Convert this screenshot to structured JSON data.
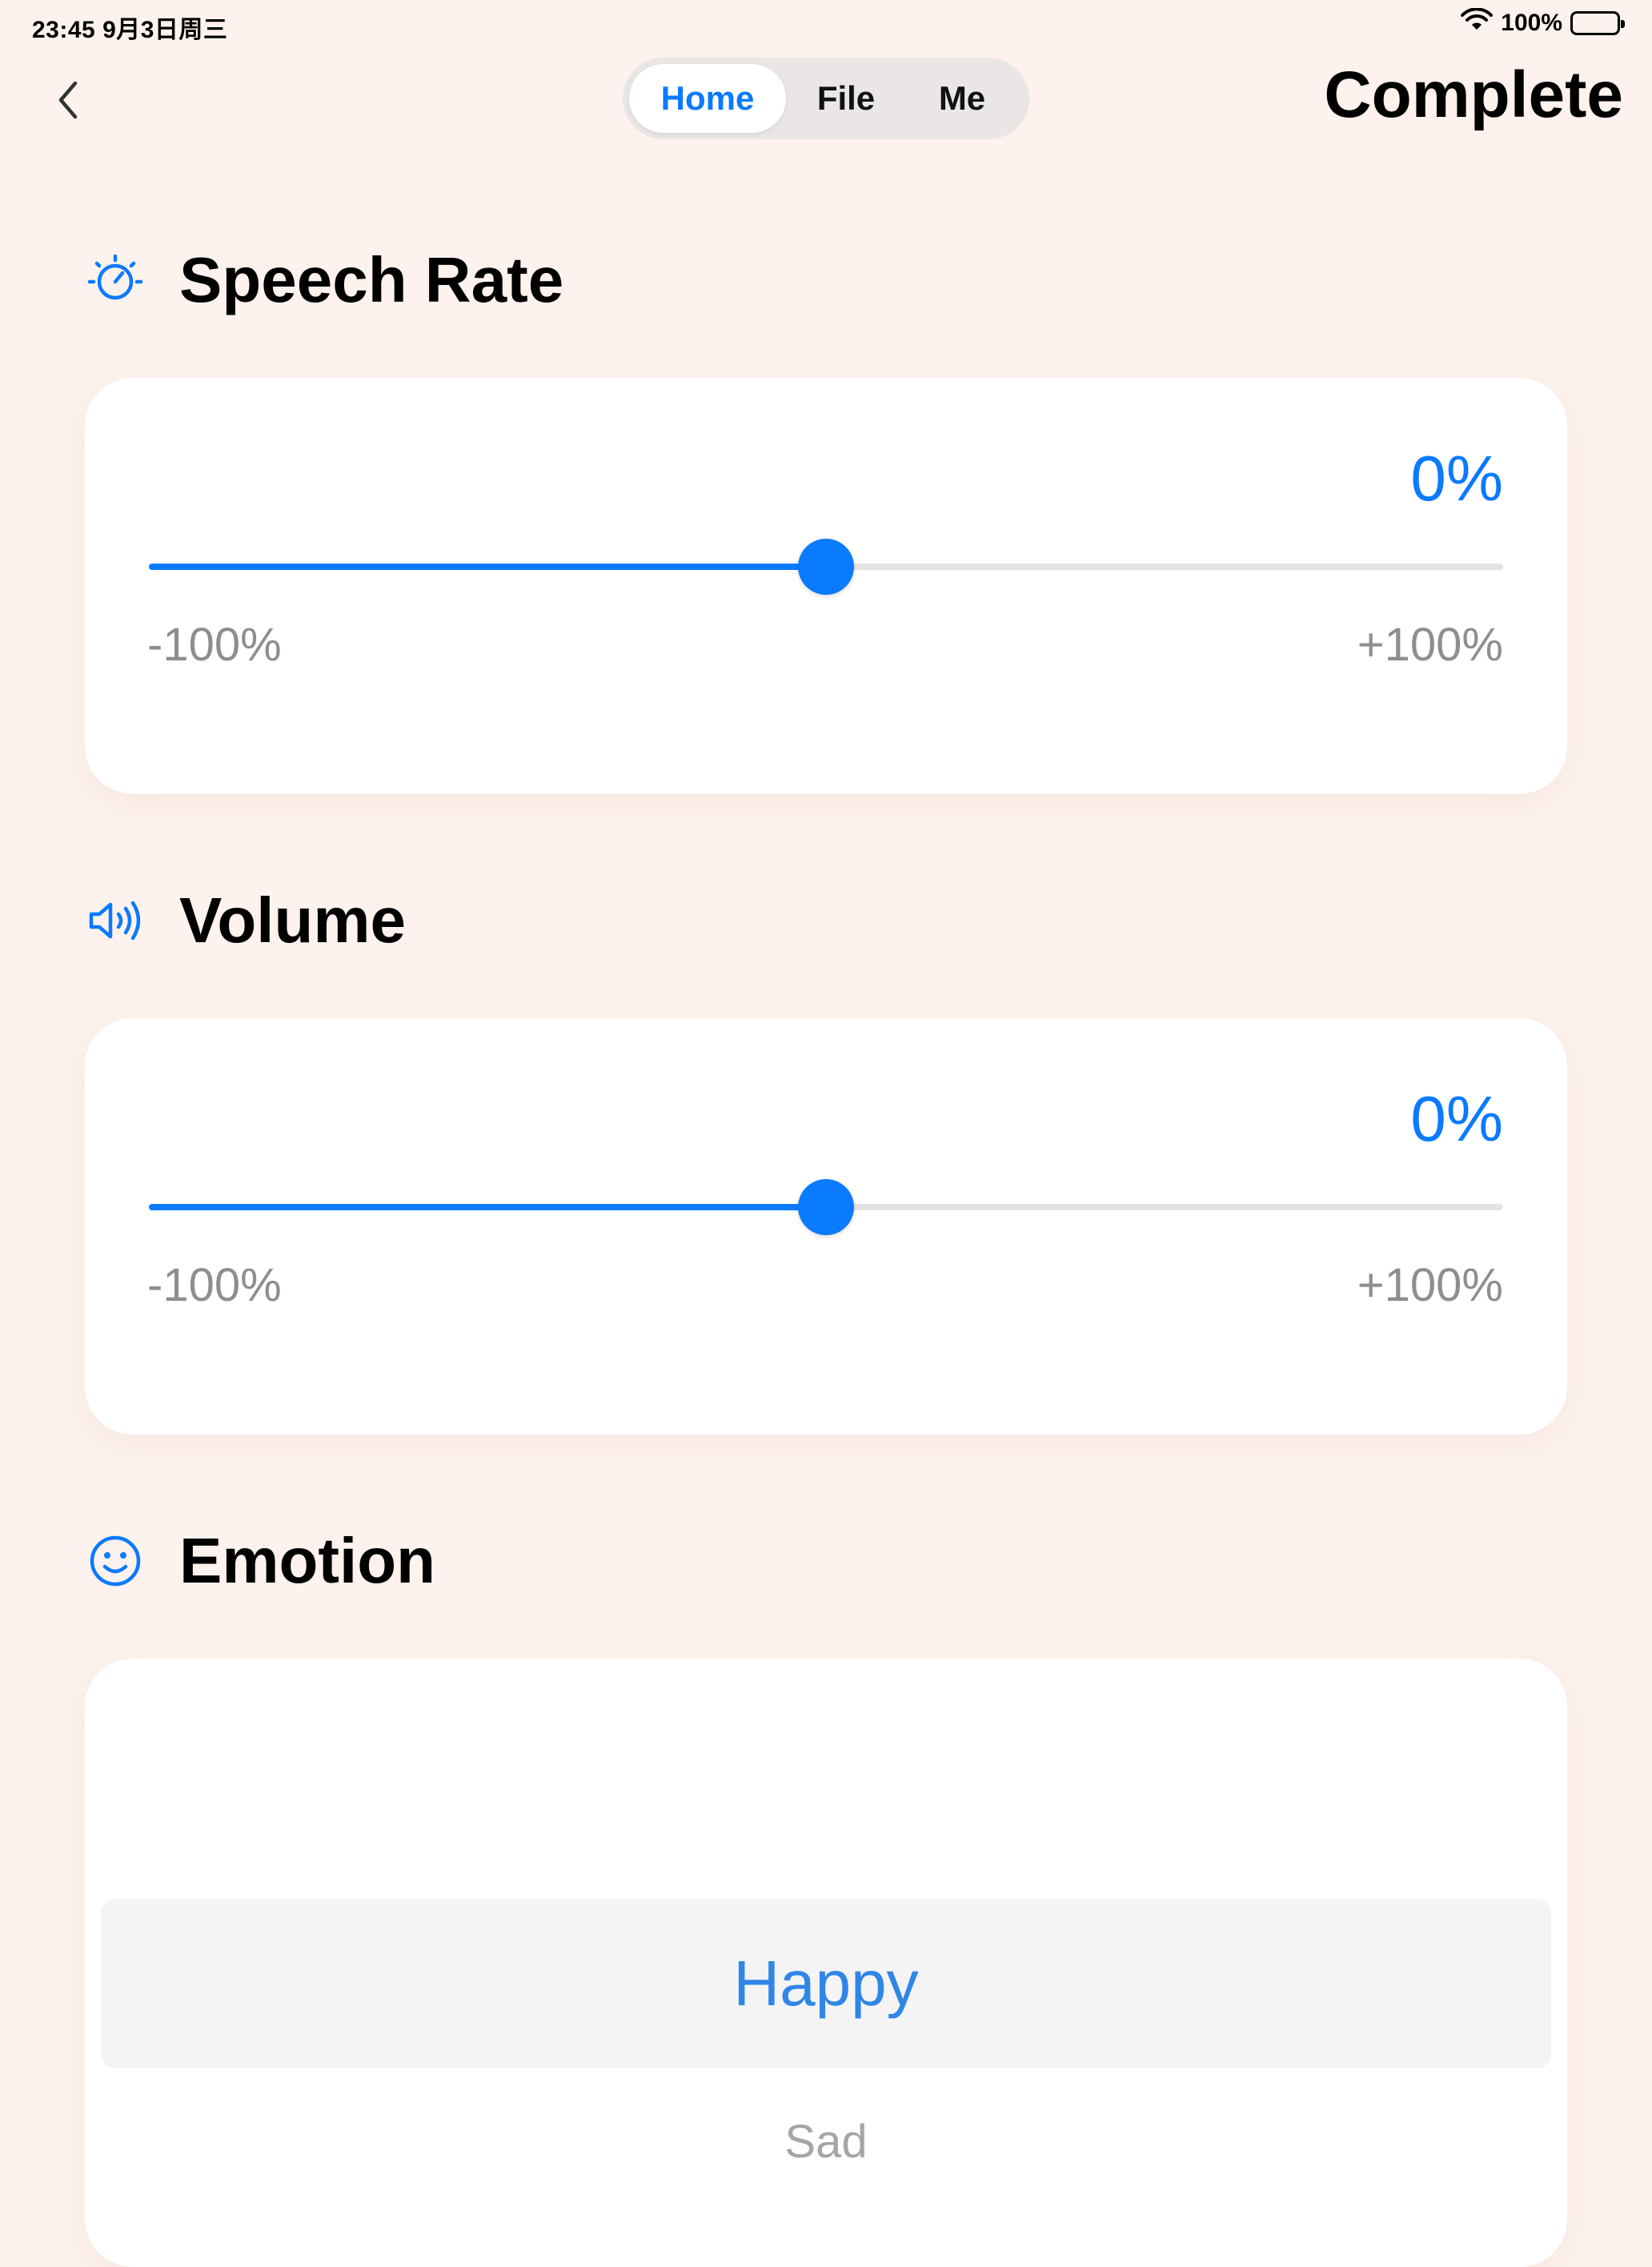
{
  "status_bar": {
    "time_date": "23:45   9月3日周三",
    "battery_text": "100%"
  },
  "nav": {
    "tabs": [
      {
        "label": "Home",
        "active": true
      },
      {
        "label": "File",
        "active": false
      },
      {
        "label": "Me",
        "active": false
      }
    ],
    "complete_label": "Complete"
  },
  "speech_rate": {
    "title": "Speech Rate",
    "value_text": "0%",
    "value": 0,
    "min_label": "-100%",
    "max_label": "+100%",
    "min": -100,
    "max": 100
  },
  "volume": {
    "title": "Volume",
    "value_text": "0%",
    "value": 0,
    "min_label": "-100%",
    "max_label": "+100%",
    "min": -100,
    "max": 100
  },
  "emotion": {
    "title": "Emotion",
    "selected": "Happy",
    "next_option": "Sad"
  },
  "colors": {
    "accent": "#0a7aff",
    "background": "#fdf2ed",
    "card": "#ffffff"
  },
  "icons": {
    "back": "chevron-left-icon",
    "speech_rate": "speedometer-icon",
    "volume": "speaker-icon",
    "emotion": "smiley-icon",
    "wifi": "wifi-icon",
    "battery": "battery-icon"
  }
}
